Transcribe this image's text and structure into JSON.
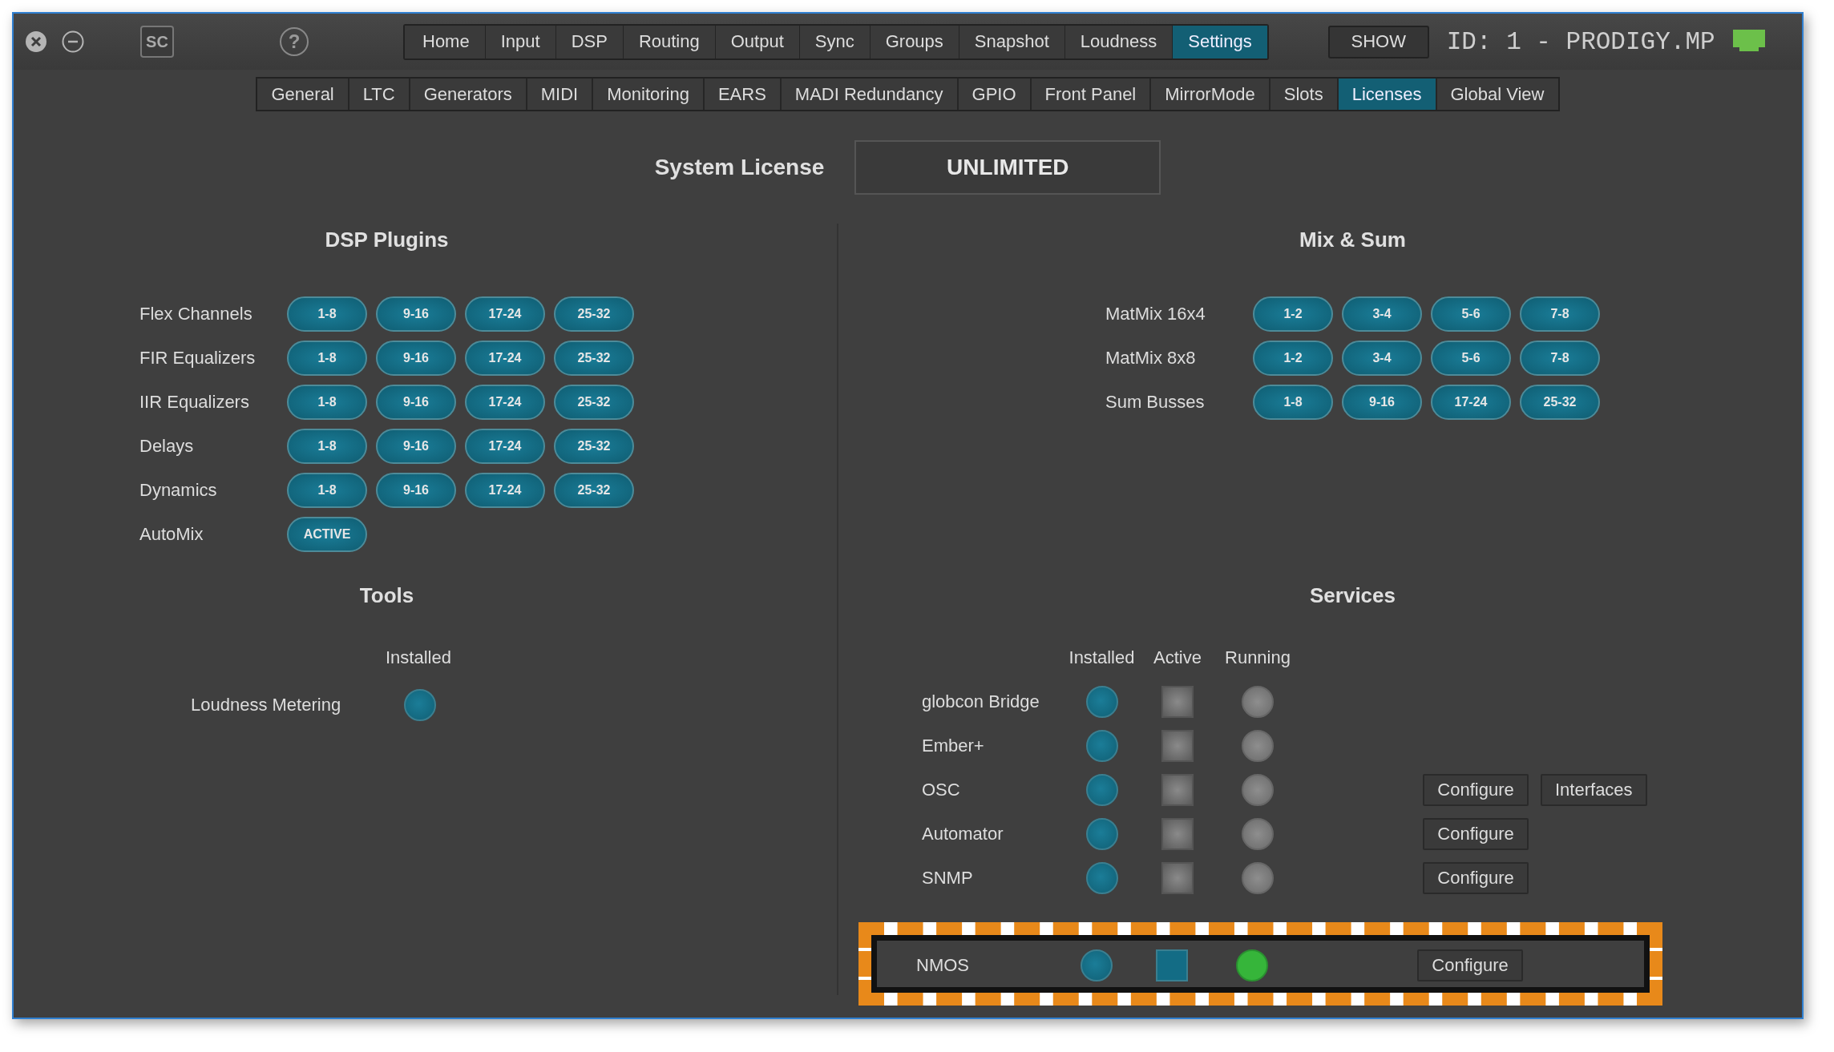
{
  "toolbar": {
    "logo": "SC",
    "help": "?"
  },
  "main_tabs": [
    {
      "label": "Home",
      "selected": false
    },
    {
      "label": "Input",
      "selected": false
    },
    {
      "label": "DSP",
      "selected": false
    },
    {
      "label": "Routing",
      "selected": false
    },
    {
      "label": "Output",
      "selected": false
    },
    {
      "label": "Sync",
      "selected": false
    },
    {
      "label": "Groups",
      "selected": false
    },
    {
      "label": "Snapshot",
      "selected": false
    },
    {
      "label": "Loudness",
      "selected": false
    },
    {
      "label": "Settings",
      "selected": true
    }
  ],
  "show_button": "SHOW",
  "device_id": "ID: 1 - PRODIGY.MP",
  "sub_tabs": [
    {
      "label": "General",
      "selected": false
    },
    {
      "label": "LTC",
      "selected": false
    },
    {
      "label": "Generators",
      "selected": false
    },
    {
      "label": "MIDI",
      "selected": false
    },
    {
      "label": "Monitoring",
      "selected": false
    },
    {
      "label": "EARS",
      "selected": false
    },
    {
      "label": "MADI Redundancy",
      "selected": false
    },
    {
      "label": "GPIO",
      "selected": false
    },
    {
      "label": "Front Panel",
      "selected": false
    },
    {
      "label": "MirrorMode",
      "selected": false
    },
    {
      "label": "Slots",
      "selected": false
    },
    {
      "label": "Licenses",
      "selected": true
    },
    {
      "label": "Global View",
      "selected": false
    }
  ],
  "system_license": {
    "label": "System License",
    "value": "UNLIMITED"
  },
  "dsp_plugins": {
    "title": "DSP Plugins",
    "rows": [
      {
        "label": "Flex Channels",
        "buttons": [
          "1-8",
          "9-16",
          "17-24",
          "25-32"
        ]
      },
      {
        "label": "FIR Equalizers",
        "buttons": [
          "1-8",
          "9-16",
          "17-24",
          "25-32"
        ]
      },
      {
        "label": "IIR Equalizers",
        "buttons": [
          "1-8",
          "9-16",
          "17-24",
          "25-32"
        ]
      },
      {
        "label": "Delays",
        "buttons": [
          "1-8",
          "9-16",
          "17-24",
          "25-32"
        ]
      },
      {
        "label": "Dynamics",
        "buttons": [
          "1-8",
          "9-16",
          "17-24",
          "25-32"
        ]
      },
      {
        "label": "AutoMix",
        "buttons": [
          "ACTIVE"
        ]
      }
    ]
  },
  "mix_sum": {
    "title": "Mix & Sum",
    "rows": [
      {
        "label": "MatMix 16x4",
        "buttons": [
          "1-2",
          "3-4",
          "5-6",
          "7-8"
        ]
      },
      {
        "label": "MatMix 8x8",
        "buttons": [
          "1-2",
          "3-4",
          "5-6",
          "7-8"
        ]
      },
      {
        "label": "Sum Busses",
        "buttons": [
          "1-8",
          "9-16",
          "17-24",
          "25-32"
        ]
      }
    ]
  },
  "tools": {
    "title": "Tools",
    "columns": [
      "Installed"
    ],
    "rows": [
      {
        "label": "Loudness Metering",
        "installed": true
      }
    ]
  },
  "services": {
    "title": "Services",
    "columns": [
      "Installed",
      "Active",
      "Running"
    ],
    "rows": [
      {
        "name": "globcon Bridge",
        "installed": true,
        "active": false,
        "running": false,
        "highlighted": false,
        "buttons": []
      },
      {
        "name": "Ember+",
        "installed": true,
        "active": false,
        "running": false,
        "highlighted": false,
        "buttons": []
      },
      {
        "name": "OSC",
        "installed": true,
        "active": false,
        "running": false,
        "highlighted": false,
        "buttons": [
          "Configure",
          "Interfaces"
        ]
      },
      {
        "name": "Automator",
        "installed": true,
        "active": false,
        "running": false,
        "highlighted": false,
        "buttons": [
          "Configure"
        ]
      },
      {
        "name": "SNMP",
        "installed": true,
        "active": false,
        "running": false,
        "highlighted": false,
        "buttons": [
          "Configure"
        ]
      },
      {
        "name": "NMOS",
        "installed": true,
        "active": true,
        "running": true,
        "highlighted": true,
        "buttons": [
          "Configure"
        ]
      }
    ]
  }
}
